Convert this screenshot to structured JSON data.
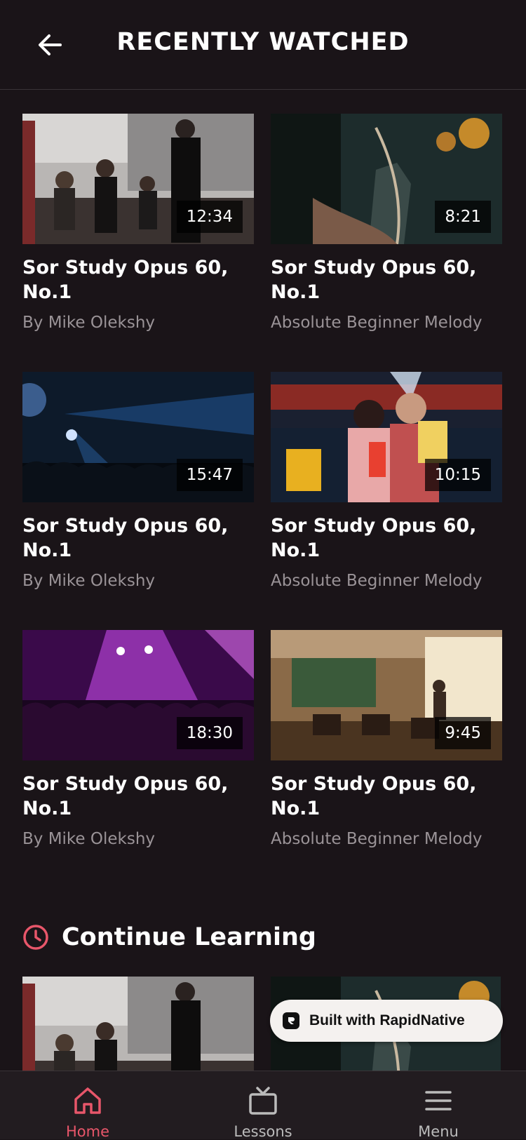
{
  "header": {
    "title": "RECENTLY WATCHED"
  },
  "recently_watched": [
    {
      "title": "Sor Study Opus 60, No.1",
      "author": "By Mike Olekshy",
      "duration": "12:34"
    },
    {
      "title": "Sor Study Opus 60, No.1",
      "author": "Absolute Beginner Melody",
      "duration": "8:21"
    },
    {
      "title": "Sor Study Opus 60, No.1",
      "author": "By Mike Olekshy",
      "duration": "15:47"
    },
    {
      "title": "Sor Study Opus 60, No.1",
      "author": "Absolute Beginner Melody",
      "duration": "10:15"
    },
    {
      "title": "Sor Study Opus 60, No.1",
      "author": "By Mike Olekshy",
      "duration": "18:30"
    },
    {
      "title": "Sor Study Opus 60, No.1",
      "author": "Absolute Beginner Melody",
      "duration": "9:45"
    }
  ],
  "continue_learning": {
    "title": "Continue Learning",
    "icon": "clock-icon"
  },
  "badge": {
    "label": "Built with RapidNative"
  },
  "tabbar": {
    "items": [
      {
        "label": "Home",
        "icon": "home-icon",
        "active": true
      },
      {
        "label": "Lessons",
        "icon": "tv-icon",
        "active": false
      },
      {
        "label": "Menu",
        "icon": "menu-icon",
        "active": false
      }
    ]
  },
  "colors": {
    "background": "#1a1418",
    "accent": "#e8566a",
    "muted_text": "#9a9397"
  }
}
